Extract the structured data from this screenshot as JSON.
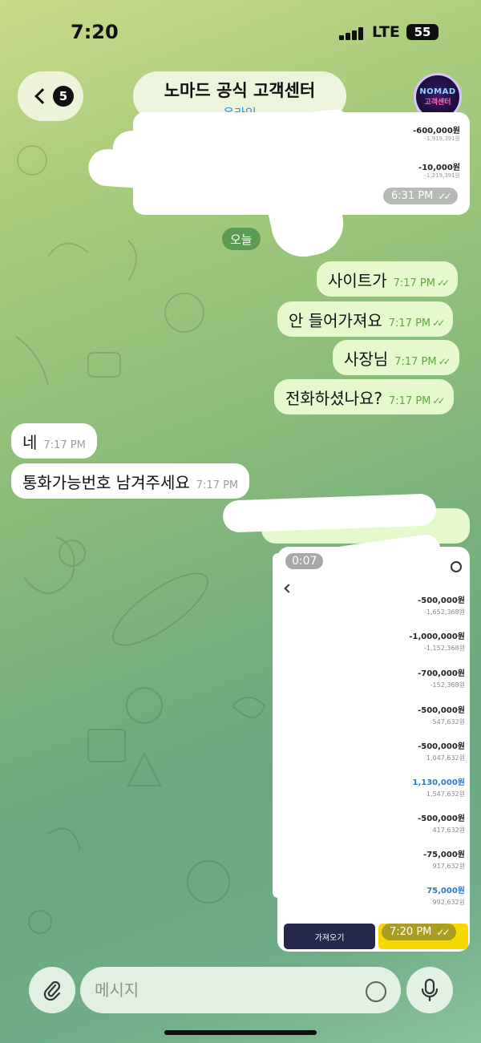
{
  "status_bar": {
    "time": "7:20",
    "network": "LTE",
    "battery": "55"
  },
  "header": {
    "back_count": "5",
    "title": "노마드 공식 고객센터",
    "subtitle": "온라인",
    "avatar_text_top": "NOMAD",
    "avatar_text_bottom": "고객센터"
  },
  "top_image_message": {
    "time": "6:31 PM",
    "amounts": [
      "-600,000원",
      "-10,000원"
    ],
    "balances": [
      "-1,919,391원",
      "-1,319,391원"
    ]
  },
  "date_separator": "오늘",
  "messages": [
    {
      "direction": "out",
      "text": "사이트가",
      "time": "7:17 PM"
    },
    {
      "direction": "out",
      "text": "안 들어가져요",
      "time": "7:17 PM"
    },
    {
      "direction": "out",
      "text": "사장님",
      "time": "7:17 PM"
    },
    {
      "direction": "out",
      "text": "전화하셨나요?",
      "time": "7:17 PM"
    },
    {
      "direction": "in",
      "text": "네",
      "time": "7:17 PM"
    },
    {
      "direction": "in",
      "text": "통화가능번호 남겨주세요",
      "time": "7:17 PM"
    }
  ],
  "bottom_image_message": {
    "video_duration": "0:07",
    "time": "7:20 PM",
    "transactions": [
      {
        "amount": "-500,000원",
        "balance": "-1,652,368원"
      },
      {
        "amount": "-1,000,000원",
        "balance": "-1,152,368원"
      },
      {
        "amount": "-700,000원",
        "balance": "-152,368원"
      },
      {
        "amount": "-500,000원",
        "balance": "547,632원"
      },
      {
        "amount": "-500,000원",
        "balance": "1,047,632원"
      },
      {
        "amount": "1,130,000원",
        "balance": "1,547,632원"
      },
      {
        "amount": "-500,000원",
        "balance": "417,632원"
      },
      {
        "amount": "-75,000원",
        "balance": "917,632원"
      },
      {
        "amount": "75,000원",
        "balance": "992,632원"
      }
    ],
    "button_label": "가져오기"
  },
  "composer": {
    "placeholder": "메시지"
  },
  "colors": {
    "outgoing_bubble": "#e5f9cd",
    "incoming_bubble": "#ffffff",
    "online": "#2d8fe0",
    "check_green": "#5daa3a"
  }
}
